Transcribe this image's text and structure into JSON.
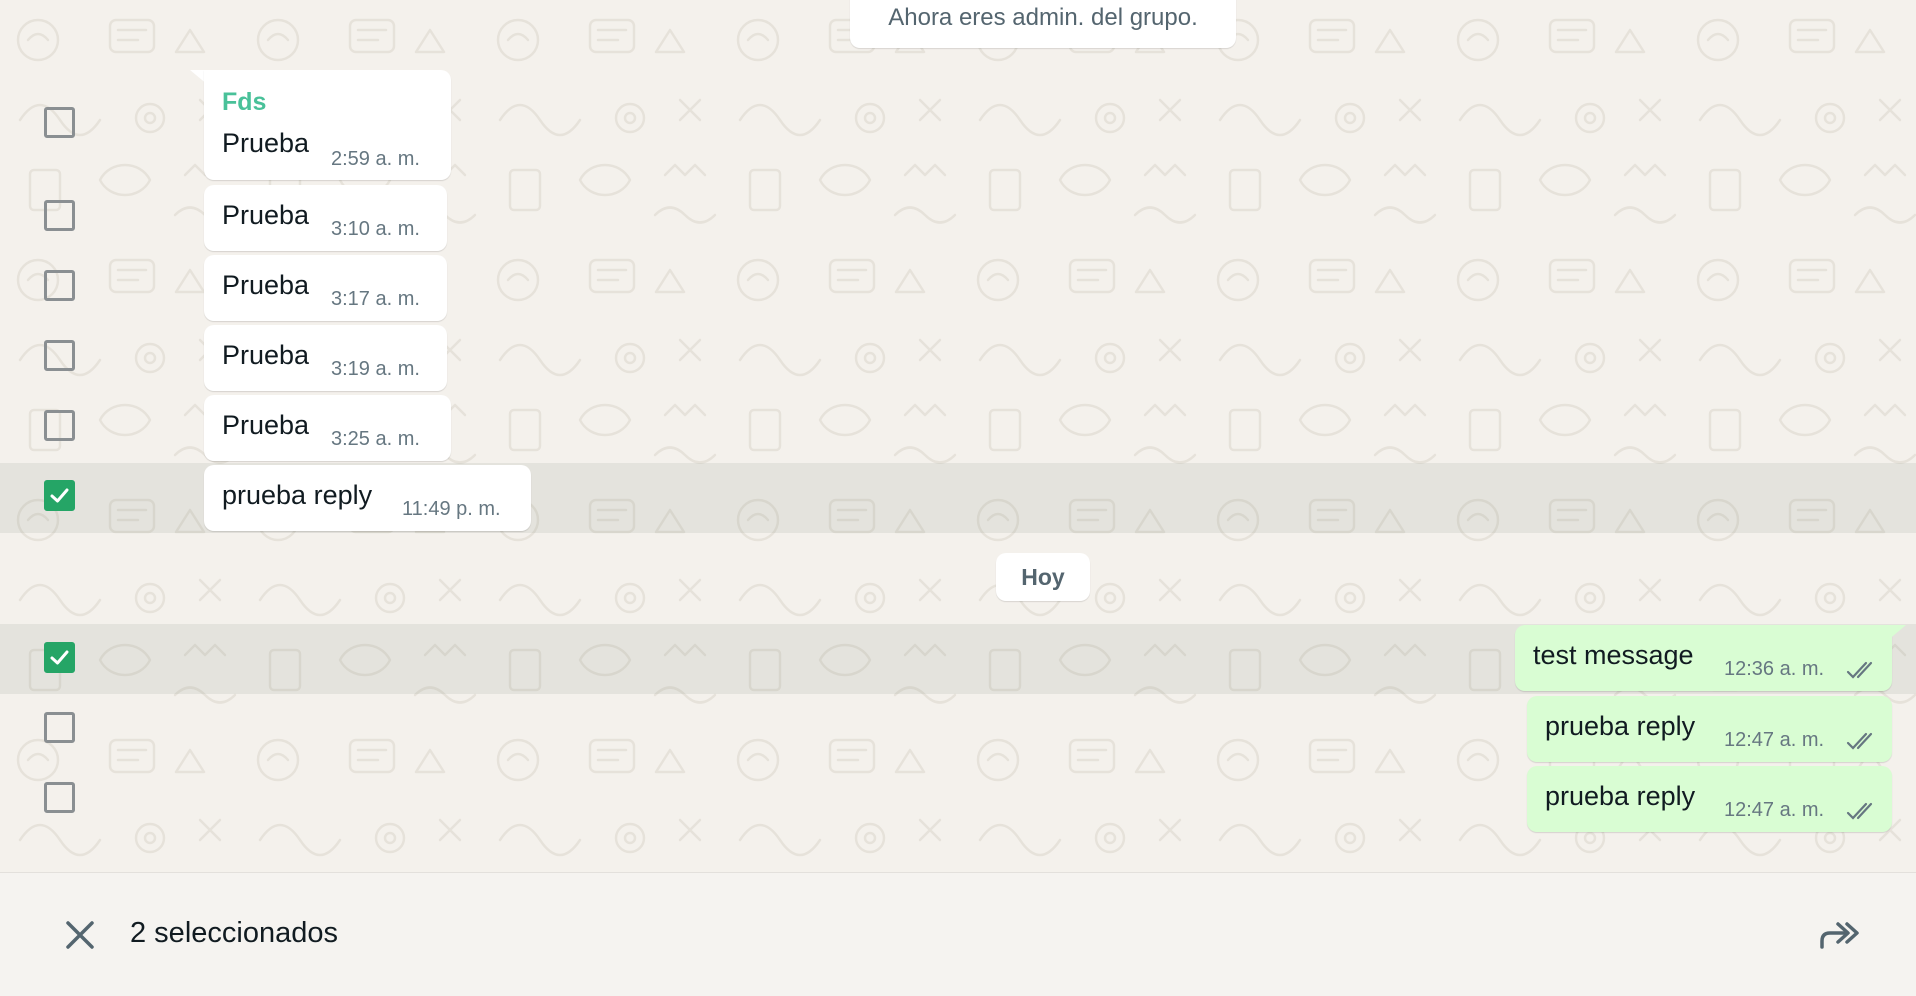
{
  "system_message": "Ahora eres admin. del grupo.",
  "date_divider": "Hoy",
  "incoming": [
    {
      "sender": "Fds",
      "text": "Prueba",
      "time": "2:59 a. m.",
      "checked": false
    },
    {
      "text": "Prueba",
      "time": "3:10 a. m.",
      "checked": false
    },
    {
      "text": "Prueba",
      "time": "3:17 a. m.",
      "checked": false
    },
    {
      "text": "Prueba",
      "time": "3:19 a. m.",
      "checked": false
    },
    {
      "text": "Prueba",
      "time": "3:25 a. m.",
      "checked": false
    },
    {
      "text": "prueba reply",
      "time": "11:49 p. m.",
      "checked": true
    }
  ],
  "outgoing": [
    {
      "text": "test message",
      "time": "12:36 a. m.",
      "status_icon": "double-check-icon",
      "checked": true
    },
    {
      "text": "prueba reply",
      "time": "12:47 a. m.",
      "status_icon": "double-check-icon",
      "checked": false
    },
    {
      "text": "prueba reply",
      "time": "12:47 a. m.",
      "status_icon": "double-check-icon",
      "checked": false
    }
  ],
  "footer": {
    "selected_label": "2 seleccionados",
    "close_icon": "close-icon",
    "forward_icon": "forward-icon"
  },
  "colors": {
    "checkbox_checked": "#25a566",
    "outgoing_bubble": "#d9fdd3",
    "sender_name": "#49c199"
  }
}
